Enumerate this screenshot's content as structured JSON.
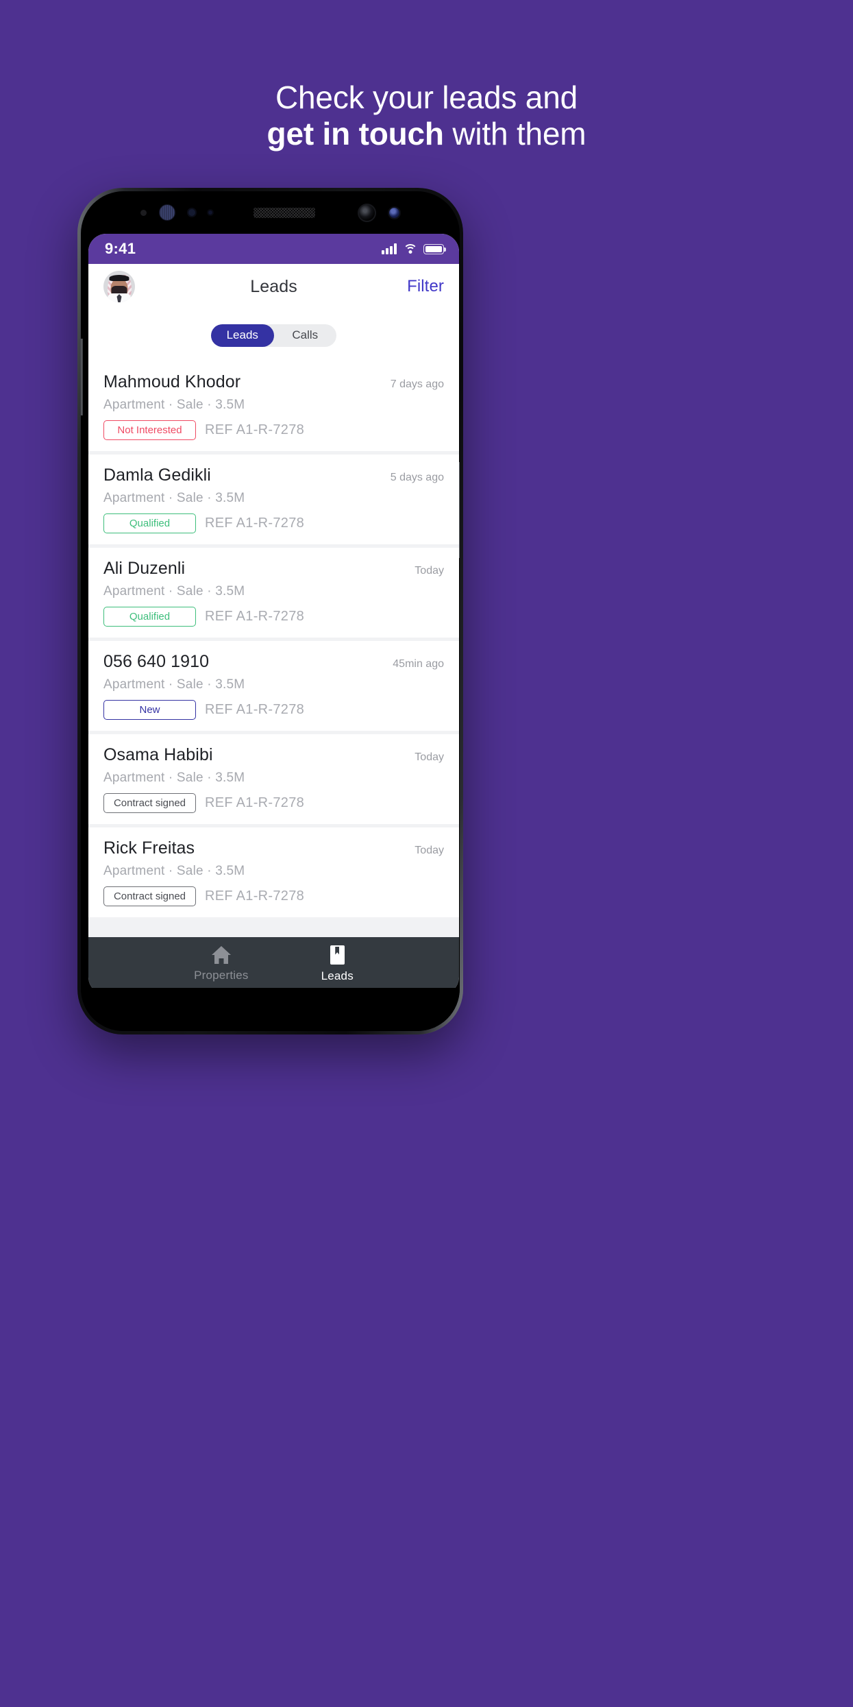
{
  "promo": {
    "line1": "Check your leads and",
    "line2_bold": "get in touch",
    "line2_rest": " with them"
  },
  "background_color": "#4E3190",
  "status_bar": {
    "time": "9:41",
    "signal_icon": "cellular-signal-icon",
    "wifi_icon": "wifi-icon",
    "battery_icon": "battery-full-icon"
  },
  "app_bar": {
    "avatar_name": "user-avatar",
    "title": "Leads",
    "action_label": "Filter",
    "action_color": "#4138C8"
  },
  "segmented_control": {
    "options": [
      {
        "label": "Leads",
        "active": true
      },
      {
        "label": "Calls",
        "active": false
      }
    ],
    "active_color": "#3432A3",
    "track_color": "#EBECEE"
  },
  "leads": [
    {
      "name": "Mahmoud Khodor",
      "time": "7 days ago",
      "meta": "Apartment · Sale · 3.5M",
      "status": "Not Interested",
      "status_style": "red",
      "status_color": "#EF4A63",
      "reference": "REF A1-R-7278"
    },
    {
      "name": "Damla Gedikli",
      "time": "5 days ago",
      "meta": "Apartment · Sale · 3.5M",
      "status": "Qualified",
      "status_style": "green",
      "status_color": "#3DBE7B",
      "reference": "REF A1-R-7278"
    },
    {
      "name": "Ali Duzenli",
      "time": "Today",
      "meta": "Apartment · Sale · 3.5M",
      "status": "Qualified",
      "status_style": "green",
      "status_color": "#3DBE7B",
      "reference": "REF A1-R-7278"
    },
    {
      "name": "056 640 1910",
      "time": "45min ago",
      "meta": "Apartment · Sale · 3.5M",
      "status": "New",
      "status_style": "blue",
      "status_color": "#3432A3",
      "reference": "REF A1-R-7278"
    },
    {
      "name": "Osama Habibi",
      "time": "Today",
      "meta": "Apartment · Sale · 3.5M",
      "status": "Contract signed",
      "status_style": "gray",
      "status_color": "#4A4C52",
      "reference": "REF A1-R-7278"
    },
    {
      "name": "Rick Freitas",
      "time": "Today",
      "meta": "Apartment · Sale · 3.5M",
      "status": "Contract signed",
      "status_style": "gray",
      "status_color": "#4A4C52",
      "reference": "REF A1-R-7278"
    }
  ],
  "tab_bar": {
    "background_color": "#343A40",
    "tabs": [
      {
        "label": "Properties",
        "icon": "home-icon",
        "active": false
      },
      {
        "label": "Leads",
        "icon": "bookmark-icon",
        "active": true
      }
    ]
  }
}
